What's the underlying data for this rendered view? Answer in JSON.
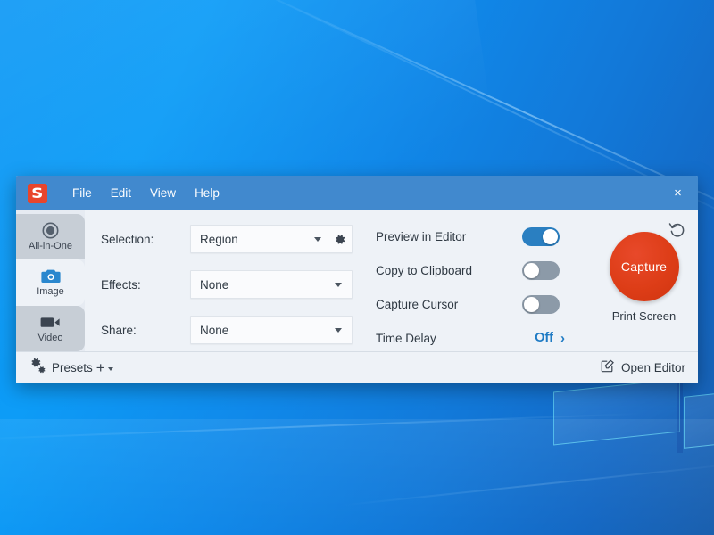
{
  "window": {
    "title_logo": "snagit-logo",
    "menu": [
      {
        "label": "File"
      },
      {
        "label": "Edit"
      },
      {
        "label": "View"
      },
      {
        "label": "Help"
      }
    ],
    "controls": {
      "minimize": "minimize-icon",
      "close": "×"
    },
    "colors": {
      "titlebar": "#4189CE",
      "panel": "#EEF2F7",
      "sidebar_grey": "#C7CED6",
      "capture_red": "#DD3D17",
      "toggle_on": "#2A7FC1",
      "toggle_off": "#8C9AA8",
      "link_blue": "#1F7BC4"
    }
  },
  "sidebar": {
    "items": [
      {
        "label": "All-in-One",
        "icon": "circle-target-icon",
        "selected": false,
        "style": "grey"
      },
      {
        "label": "Image",
        "icon": "camera-icon",
        "selected": true,
        "style": "light"
      },
      {
        "label": "Video",
        "icon": "camcorder-icon",
        "selected": false,
        "style": "grey"
      }
    ]
  },
  "settings": {
    "rows": [
      {
        "label": "Selection:",
        "value": "Region",
        "has_gear": true,
        "gear_icon": "gear-icon"
      },
      {
        "label": "Effects:",
        "value": "None",
        "has_gear": false
      },
      {
        "label": "Share:",
        "value": "None",
        "has_gear": false
      }
    ]
  },
  "options": {
    "toggles": [
      {
        "label": "Preview in Editor",
        "state": "on"
      },
      {
        "label": "Copy to Clipboard",
        "state": "off"
      },
      {
        "label": "Capture Cursor",
        "state": "off"
      }
    ],
    "time_delay": {
      "label": "Time Delay",
      "value": "Off",
      "chevron": "›"
    }
  },
  "capture": {
    "button_label": "Capture",
    "caption": "Print Screen",
    "reset_icon": "undo-reset-icon"
  },
  "footer": {
    "presets_label": "Presets",
    "presets_icon": "double-gear-icon",
    "add_plus": "+",
    "open_editor_label": "Open Editor",
    "open_editor_icon": "edit-square-icon"
  }
}
